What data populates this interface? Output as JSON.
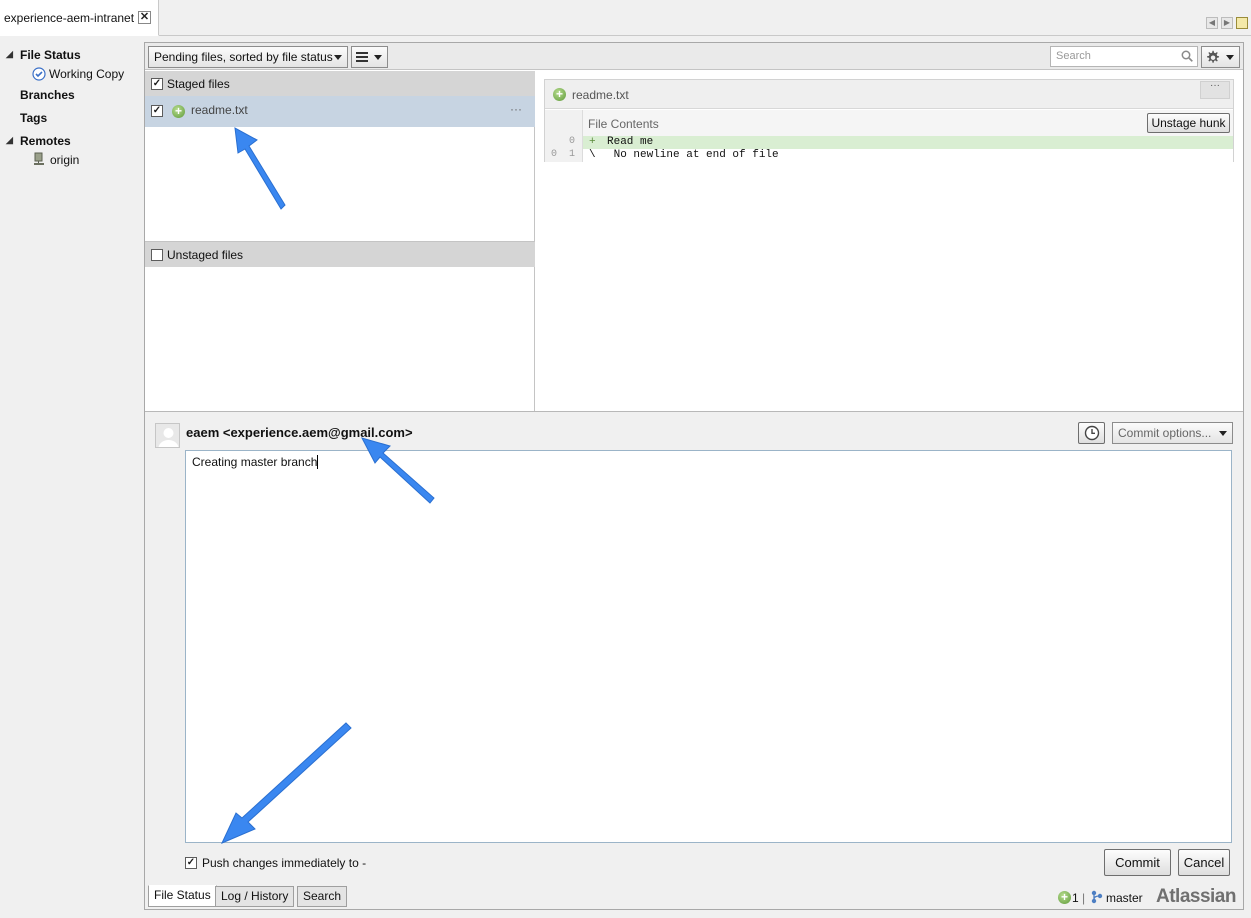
{
  "tabbar": {
    "repo_tab_label": "experience-aem-intranet",
    "close_glyph": "✕"
  },
  "sidebar": {
    "file_status": "File Status",
    "working_copy": "Working Copy",
    "branches": "Branches",
    "tags": "Tags",
    "remotes": "Remotes",
    "remote_origin": "origin"
  },
  "toolbar": {
    "sort_dropdown": "Pending files, sorted by file status",
    "search_placeholder": "Search"
  },
  "staged": {
    "header": "Staged files",
    "files": [
      {
        "name": "readme.txt",
        "more": "···"
      }
    ]
  },
  "unstaged": {
    "header": "Unstaged files"
  },
  "diff": {
    "file_name": "readme.txt",
    "header_more": "···",
    "hunk_title": "File Contents",
    "unstage_hunk": "Unstage hunk",
    "lines": [
      {
        "old": "",
        "new": "0",
        "marker": "+",
        "text": "Read me",
        "type": "add"
      },
      {
        "old": "0",
        "new": "1",
        "marker": "\\",
        "text": " No newline at end of file",
        "type": "meta"
      }
    ]
  },
  "commit": {
    "author": "eaem <experience.aem@gmail.com>",
    "options_label": "Commit options...",
    "message": "Creating master branch",
    "push_label": "Push changes immediately to -",
    "commit_button": "Commit",
    "cancel_button": "Cancel"
  },
  "bottom_tabs": [
    "File Status",
    "Log / History",
    "Search"
  ],
  "status": {
    "pending_count": "1",
    "separator": "|",
    "branch": "master",
    "brand": "Atlassian"
  },
  "colors": {
    "selection": "#c7d4e2",
    "added_line": "#d9eed2",
    "annotation_arrow": "#3a87f0"
  }
}
